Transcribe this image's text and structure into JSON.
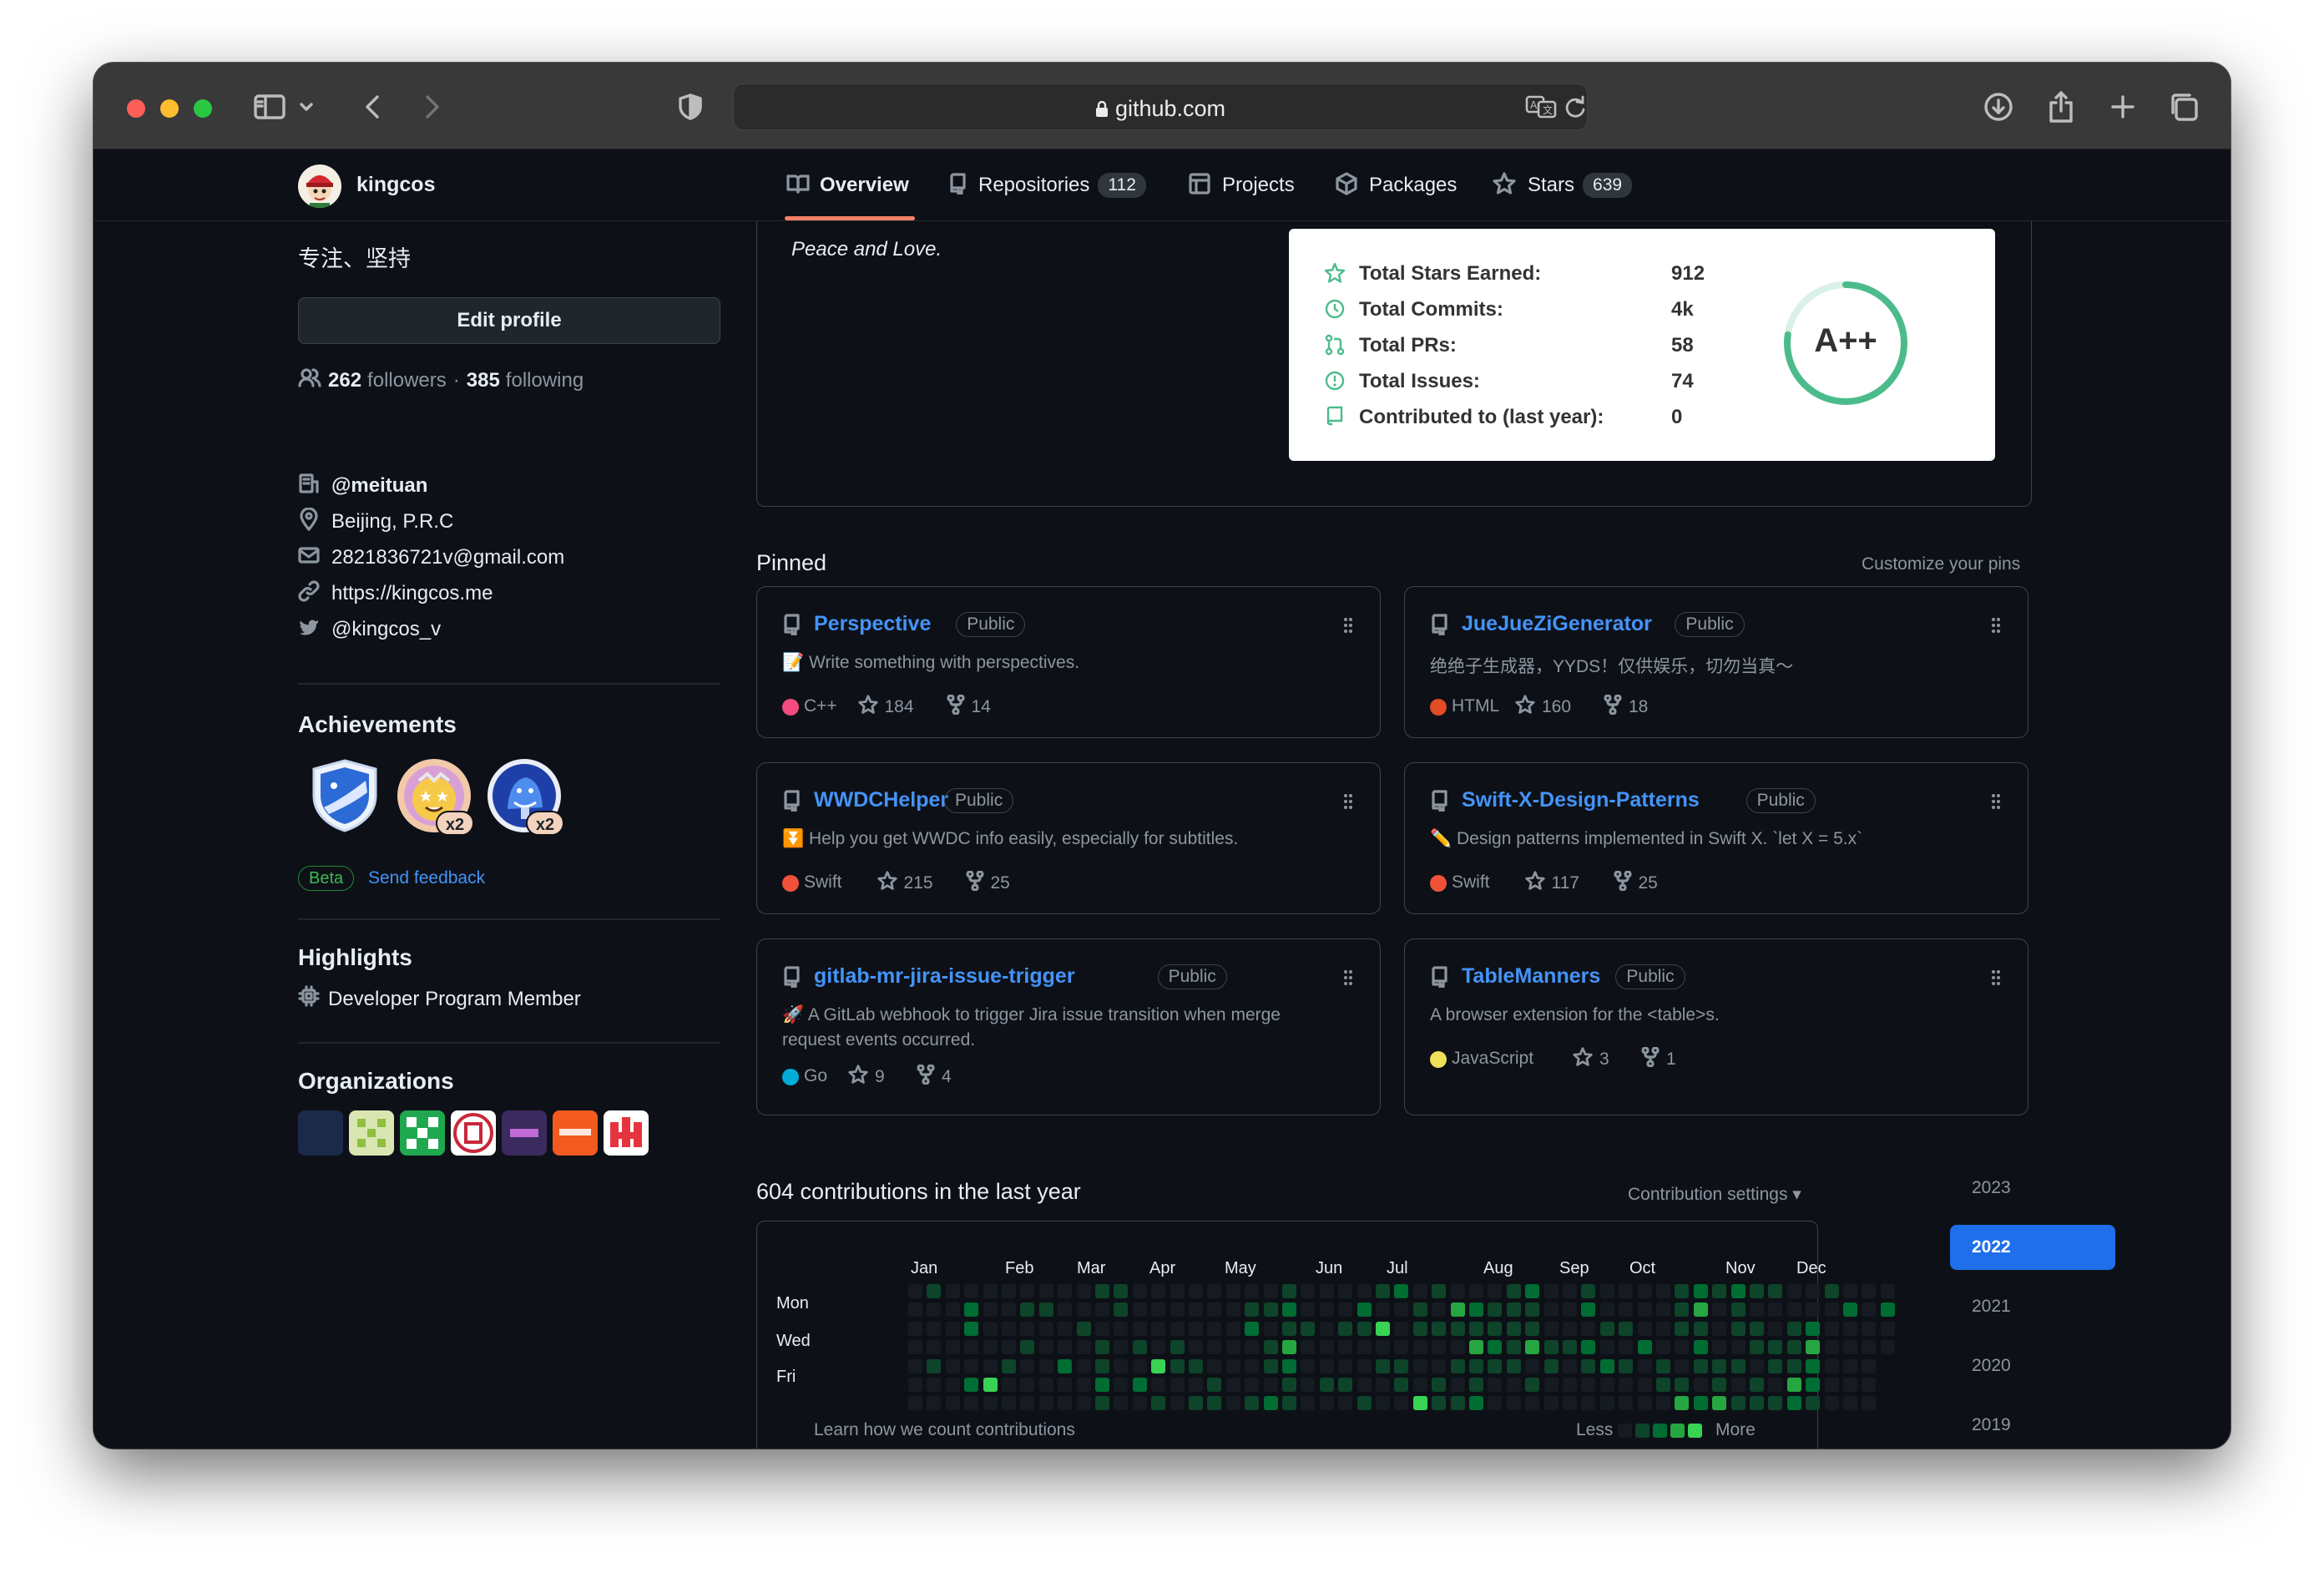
{
  "browser": {
    "url": "github.com",
    "colors": {
      "close": "#fe5f57",
      "minimize": "#febc2e",
      "zoom": "#28c840"
    },
    "icons": [
      "sidebar-icon",
      "chevron-down-icon",
      "back-icon",
      "forward-icon",
      "shield-icon",
      "lock-icon",
      "translate-icon",
      "reload-icon",
      "download-icon",
      "share-icon",
      "new-tab-icon",
      "tabs-overview-icon"
    ]
  },
  "header": {
    "username": "kingcos",
    "tabs": [
      {
        "label": "Overview",
        "icon": "book-icon",
        "active": true
      },
      {
        "label": "Repositories",
        "icon": "repo-icon",
        "count": "112"
      },
      {
        "label": "Projects",
        "icon": "table-icon"
      },
      {
        "label": "Packages",
        "icon": "package-icon"
      },
      {
        "label": "Stars",
        "icon": "star-icon",
        "count": "639"
      }
    ]
  },
  "profile": {
    "bio": "专注、坚持",
    "edit_button": "Edit profile",
    "followers_count": "262",
    "followers_label": "followers",
    "separator": "·",
    "following_count": "385",
    "following_label": "following",
    "details": [
      {
        "icon": "organization-icon",
        "text": "@meituan"
      },
      {
        "icon": "location-icon",
        "text": "Beijing, P.R.C"
      },
      {
        "icon": "mail-icon",
        "text": "2821836721v@gmail.com"
      },
      {
        "icon": "link-icon",
        "text": "https://kingcos.me"
      },
      {
        "icon": "twitter-icon",
        "text": "@kingcos_v"
      }
    ],
    "achievements": {
      "title": "Achievements",
      "badges": [
        {
          "icon": "arctic-code-vault-icon"
        },
        {
          "icon": "starstruck-icon",
          "multiplier": "x2"
        },
        {
          "icon": "pull-shark-icon",
          "multiplier": "x2"
        }
      ],
      "beta_label": "Beta",
      "feedback_label": "Send feedback"
    },
    "highlights": {
      "title": "Highlights",
      "item": "Developer Program Member",
      "item_icon": "cpu-icon"
    },
    "organizations": {
      "title": "Organizations",
      "colors": [
        "#1c2a4a",
        "#d9e6b2",
        "#1fa84f",
        "#c8283a",
        "#3b2a5e",
        "#f25a1f",
        "#e6343f"
      ]
    }
  },
  "readme": {
    "quote": "Peace and Love.",
    "stats": [
      {
        "icon": "star-icon",
        "label": "Total Stars Earned:",
        "value": "912"
      },
      {
        "icon": "history-icon",
        "label": "Total Commits:",
        "value": "4k"
      },
      {
        "icon": "pull-request-icon",
        "label": "Total PRs:",
        "value": "58"
      },
      {
        "icon": "issue-icon",
        "label": "Total Issues:",
        "value": "74"
      },
      {
        "icon": "repo-icon",
        "label": "Contributed to (last year):",
        "value": "0"
      }
    ],
    "grade": "A++",
    "grade_color": "#4cbb8b"
  },
  "pinned": {
    "title": "Pinned",
    "customize": "Customize your pins",
    "visibility": "Public",
    "repos": [
      {
        "name": "Perspective",
        "emoji": "📝",
        "description": "Write something with perspectives.",
        "language": "C++",
        "lang_color": "#f34b7d",
        "stars": "184",
        "forks": "14"
      },
      {
        "name": "JueJueZiGenerator",
        "emoji": "",
        "description": "绝绝子生成器，YYDS！仅供娱乐，切勿当真～",
        "language": "HTML",
        "lang_color": "#e34c26",
        "stars": "160",
        "forks": "18"
      },
      {
        "name": "WWDCHelper",
        "emoji": "⏬",
        "description": "Help you get WWDC info easily, especially for subtitles.",
        "language": "Swift",
        "lang_color": "#f05138",
        "stars": "215",
        "forks": "25"
      },
      {
        "name": "Swift-X-Design-Patterns",
        "emoji": "✏️",
        "description": "Design patterns implemented in Swift X. `let X = 5.x`",
        "language": "Swift",
        "lang_color": "#f05138",
        "stars": "117",
        "forks": "25"
      },
      {
        "name": "gitlab-mr-jira-issue-trigger",
        "emoji": "🚀",
        "description": "A GitLab webhook to trigger Jira issue transition when merge",
        "description2": "request events occurred.",
        "language": "Go",
        "lang_color": "#00add8",
        "stars": "9",
        "forks": "4"
      },
      {
        "name": "TableManners",
        "emoji": "",
        "description": "A browser extension for the <table>s.",
        "language": "JavaScript",
        "lang_color": "#f1e05a",
        "stars": "3",
        "forks": "1"
      }
    ]
  },
  "contributions": {
    "title": "604 contributions in the last year",
    "settings": "Contribution settings ▾",
    "months": [
      "Jan",
      "Feb",
      "Mar",
      "Apr",
      "May",
      "Jun",
      "Jul",
      "Aug",
      "Sep",
      "Oct",
      "Nov",
      "Dec"
    ],
    "days": [
      "Mon",
      "Wed",
      "Fri"
    ],
    "footer_left": "Learn how we count contributions",
    "less": "Less",
    "more": "More",
    "colors": [
      "#161b22",
      "#0e4429",
      "#006d32",
      "#26a641",
      "#39d353"
    ],
    "years": [
      "2023",
      "2022",
      "2021",
      "2020",
      "2019"
    ],
    "selected_year": "2022"
  }
}
